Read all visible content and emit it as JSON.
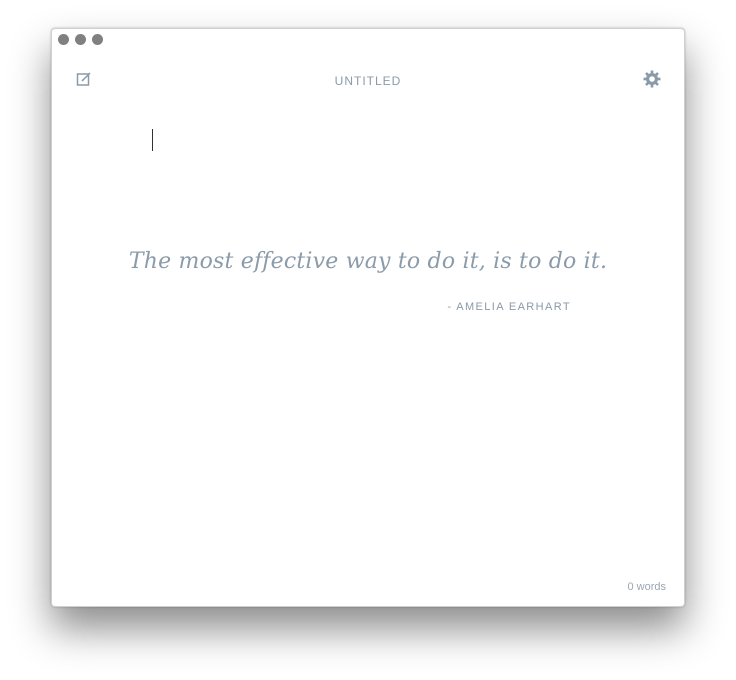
{
  "window": {
    "title": "UNTITLED",
    "controls": [
      "close",
      "minimize",
      "zoom"
    ]
  },
  "toolbar": {
    "compose_icon": "compose-icon",
    "settings_icon": "gear-icon"
  },
  "editor": {
    "content": ""
  },
  "placeholder_quote": {
    "text": "The most effective way to do it, is to do it.",
    "author": "- AMELIA EARHART"
  },
  "status": {
    "word_count": "0 words"
  },
  "colors": {
    "accent": "#8a9aa8",
    "traffic_light": "#808080"
  }
}
